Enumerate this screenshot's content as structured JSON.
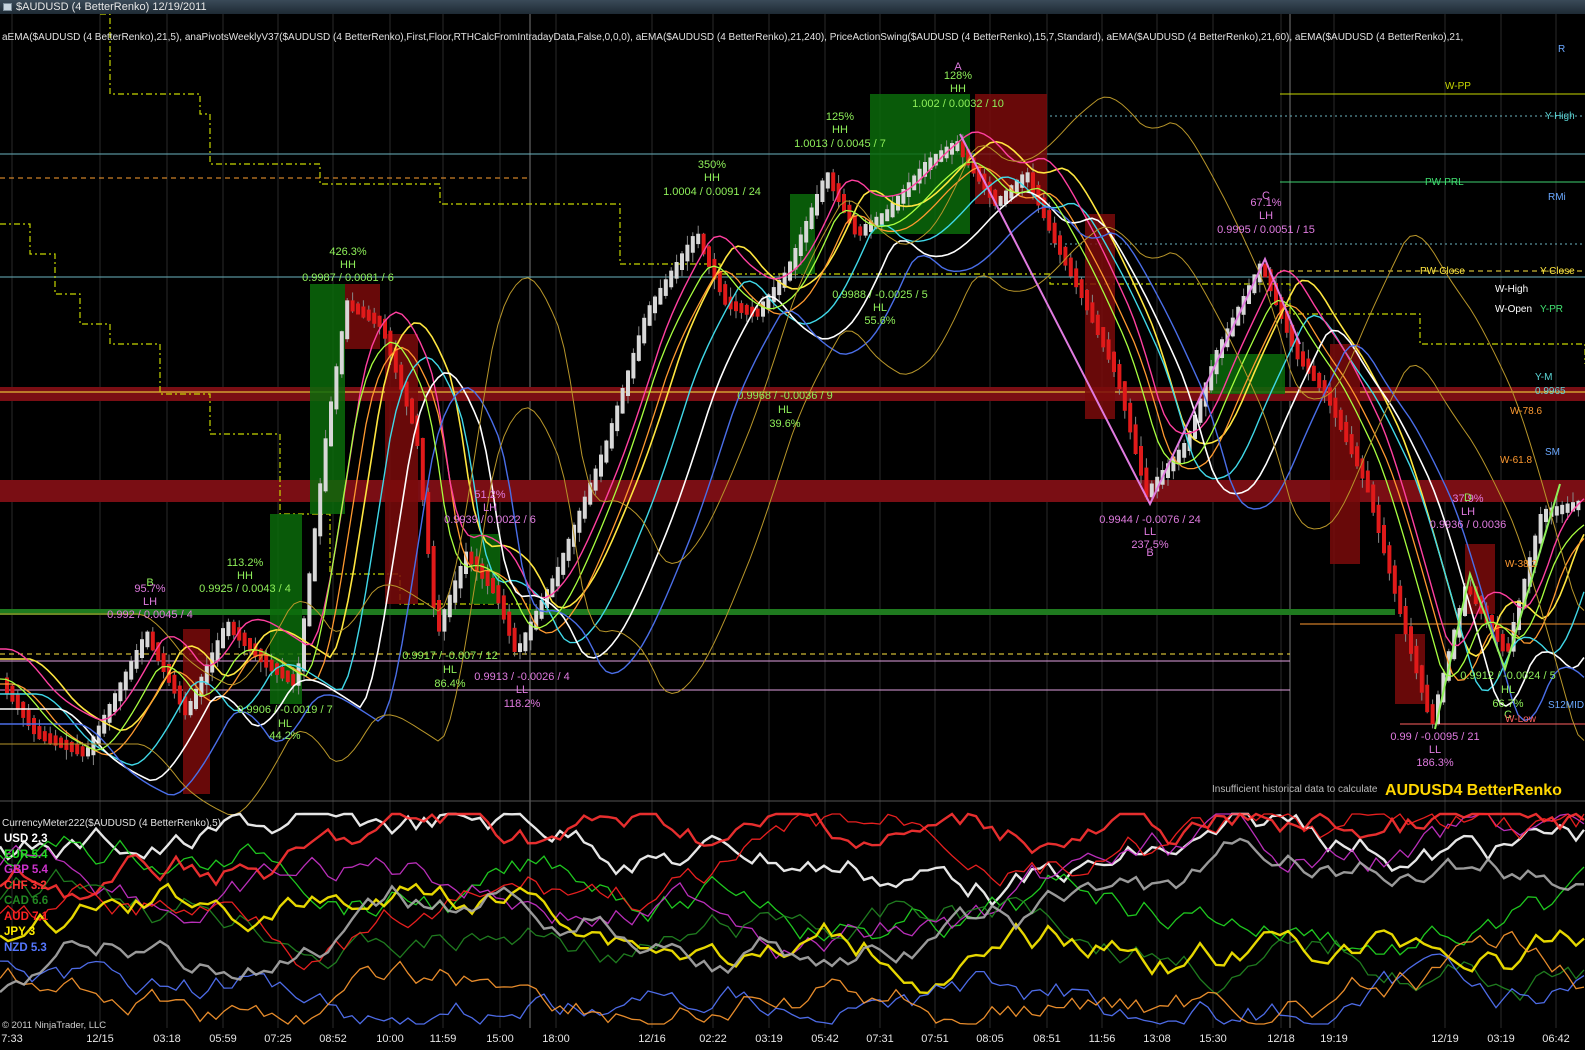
{
  "window": {
    "title": "$AUDUSD (4 BetterRenko)  12/19/2011"
  },
  "price_panel": {
    "indicator_line": "aEMA($AUDUSD (4 BetterRenko),21,5), anaPivotsWeeklyV37($AUDUSD (4 BetterRenko),First,Floor,RTHCalcFromIntradayData,False,0,0,0), aEMA($AUDUSD (4 BetterRenko),21,240), PriceActionSwing($AUDUSD (4 BetterRenko),15,7,Standard), aEMA($AUDUSD (4 BetterRenko),21,60), aEMA($AUDUSD (4 BetterRenko),21,",
    "instrument_label": "AUDUSD4 BetterRenko",
    "insufficient_msg": "Insufficient historical data to calculate",
    "swing_labels": [
      {
        "text": "426.3%",
        "color": "#8ff05a"
      },
      {
        "text": "HH",
        "color": "#8ff05a"
      },
      {
        "text": "0.9987 / 0.0081 / 6",
        "color": "#8ff05a"
      },
      {
        "text": "113.2%",
        "color": "#8ff05a"
      },
      {
        "text": "HH",
        "color": "#8ff05a"
      },
      {
        "text": "0.9925 / 0.0043 / 4",
        "color": "#8ff05a"
      },
      {
        "text": "B",
        "color": "#8ff05a"
      },
      {
        "text": "95.7%",
        "color": "#e07be0"
      },
      {
        "text": "LH",
        "color": "#e07be0"
      },
      {
        "text": "0.992 / 0.0045 / 4",
        "color": "#e07be0"
      },
      {
        "text": "0.9906 / -0.0019 / 7",
        "color": "#8ff05a"
      },
      {
        "text": "HL",
        "color": "#8ff05a"
      },
      {
        "text": "44.2%",
        "color": "#8ff05a"
      },
      {
        "text": "51.2%",
        "color": "#e07be0"
      },
      {
        "text": "LH",
        "color": "#e07be0"
      },
      {
        "text": "0.9939 / 0.0022 / 6",
        "color": "#e07be0"
      },
      {
        "text": "0.9917 / -0.007 / 12",
        "color": "#8ff05a"
      },
      {
        "text": "HL",
        "color": "#8ff05a"
      },
      {
        "text": "86.4%",
        "color": "#8ff05a"
      },
      {
        "text": "0.9913 / -0.0026 / 4",
        "color": "#e07be0"
      },
      {
        "text": "LL",
        "color": "#e07be0"
      },
      {
        "text": "118.2%",
        "color": "#e07be0"
      },
      {
        "text": "350%",
        "color": "#8ff05a"
      },
      {
        "text": "HH",
        "color": "#8ff05a"
      },
      {
        "text": "1.0004 / 0.0091 / 24",
        "color": "#8ff05a"
      },
      {
        "text": "125%",
        "color": "#8ff05a"
      },
      {
        "text": "HH",
        "color": "#8ff05a"
      },
      {
        "text": "1.0013 / 0.0045 / 7",
        "color": "#8ff05a"
      },
      {
        "text": "A",
        "color": "#e07be0"
      },
      {
        "text": "128%",
        "color": "#8ff05a"
      },
      {
        "text": "HH",
        "color": "#8ff05a"
      },
      {
        "text": "1.002 / 0.0032 / 10",
        "color": "#8ff05a"
      },
      {
        "text": "0.9988 / -0.0025 / 5",
        "color": "#8ff05a"
      },
      {
        "text": "HL",
        "color": "#8ff05a"
      },
      {
        "text": "55.6%",
        "color": "#8ff05a"
      },
      {
        "text": "0.9968 / -0.0036 / 9",
        "color": "#8ff05a"
      },
      {
        "text": "HL",
        "color": "#8ff05a"
      },
      {
        "text": "39.6%",
        "color": "#8ff05a"
      },
      {
        "text": "C",
        "color": "#e07be0"
      },
      {
        "text": "67.1%",
        "color": "#e07be0"
      },
      {
        "text": "LH",
        "color": "#e07be0"
      },
      {
        "text": "0.9995 / 0.0051 / 15",
        "color": "#e07be0"
      },
      {
        "text": "0.9944 / -0.0076 / 24",
        "color": "#e07be0"
      },
      {
        "text": "LL",
        "color": "#e07be0"
      },
      {
        "text": "237.5%",
        "color": "#e07be0"
      },
      {
        "text": "B",
        "color": "#e07be0"
      },
      {
        "text": "37.9%",
        "color": "#e07be0"
      },
      {
        "text": "LH",
        "color": "#e07be0"
      },
      {
        "text": "0.9936 / 0.0036",
        "color": "#e07be0"
      },
      {
        "text": "D",
        "color": "#8ff05a"
      },
      {
        "text": "0.9912 / -0.0024 / 5",
        "color": "#8ff05a"
      },
      {
        "text": "HL",
        "color": "#8ff05a"
      },
      {
        "text": "66.7%",
        "color": "#8ff05a"
      },
      {
        "text": "C",
        "color": "#8ff05a"
      },
      {
        "text": "0.99 / -0.0095 / 21",
        "color": "#e07be0"
      },
      {
        "text": "LL",
        "color": "#e07be0"
      },
      {
        "text": "186.3%",
        "color": "#e07be0"
      }
    ],
    "pivot_labels": [
      {
        "text": "W-PP",
        "color": "#c6d600"
      },
      {
        "text": "Y-High",
        "color": "#5bd6d6"
      },
      {
        "text": "PW-PRL",
        "color": "#40e070"
      },
      {
        "text": "RMi",
        "color": "#6aa8ff"
      },
      {
        "text": "PW-Close",
        "color": "#ffe640"
      },
      {
        "text": "Y-Close",
        "color": "#ffe640"
      },
      {
        "text": "W-Open",
        "color": "#ffffff"
      },
      {
        "text": "Y-PR",
        "color": "#40e070"
      },
      {
        "text": "W-High",
        "color": "#ffffff"
      },
      {
        "text": "Y-M",
        "color": "#5bd6d6"
      },
      {
        "text": "0.9965",
        "color": "#5bd6d6"
      },
      {
        "text": "W-78.6",
        "color": "#ff9a30"
      },
      {
        "text": "W-61.8",
        "color": "#ff9a30"
      },
      {
        "text": "SM",
        "color": "#6aa8ff"
      },
      {
        "text": "W-38.2",
        "color": "#ff9a30"
      },
      {
        "text": "S12MID",
        "color": "#6aa8ff"
      },
      {
        "text": "W-Low",
        "color": "#ff6060"
      },
      {
        "text": "R",
        "color": "#6aa8ff"
      }
    ]
  },
  "currency_meter": {
    "indicator_line": "CurrencyMeter222($AUDUSD (4 BetterRenko),5)",
    "legend": [
      {
        "currency": "USD",
        "value": "2.3",
        "color": "#ffffff"
      },
      {
        "currency": "EUR",
        "value": "5.4",
        "color": "#22dd22"
      },
      {
        "currency": "GBP",
        "value": "5.4",
        "color": "#cc33cc"
      },
      {
        "currency": "CHF",
        "value": "3.2",
        "color": "#ff3333"
      },
      {
        "currency": "CAD",
        "value": "6.6",
        "color": "#228822"
      },
      {
        "currency": "AUD",
        "value": "7.1",
        "color": "#ff2222"
      },
      {
        "currency": "JPY",
        "value": "3",
        "color": "#ffee00"
      },
      {
        "currency": "NZD",
        "value": "5.3",
        "color": "#5577ff"
      }
    ]
  },
  "x_axis": {
    "labels": [
      "7:33",
      "12/15",
      "03:18",
      "05:59",
      "07:25",
      "08:52",
      "10:00",
      "11:59",
      "15:00",
      "18:00",
      "12/16",
      "02:22",
      "03:19",
      "05:42",
      "07:31",
      "07:51",
      "08:05",
      "08:51",
      "11:56",
      "13:08",
      "15:30",
      "12/18",
      "19:19",
      "12/19",
      "03:19",
      "06:42"
    ]
  },
  "copyright": "© 2011 NinjaTrader, LLC",
  "colors": {
    "background": "#000000",
    "grid": "#2a2a2a",
    "bull_box": "#0a6a0a",
    "bear_box": "#7a0a0a",
    "up_candle": "#d8d8d8",
    "down_candle": "#e01a1a",
    "green_bar": "#2aa62a"
  }
}
